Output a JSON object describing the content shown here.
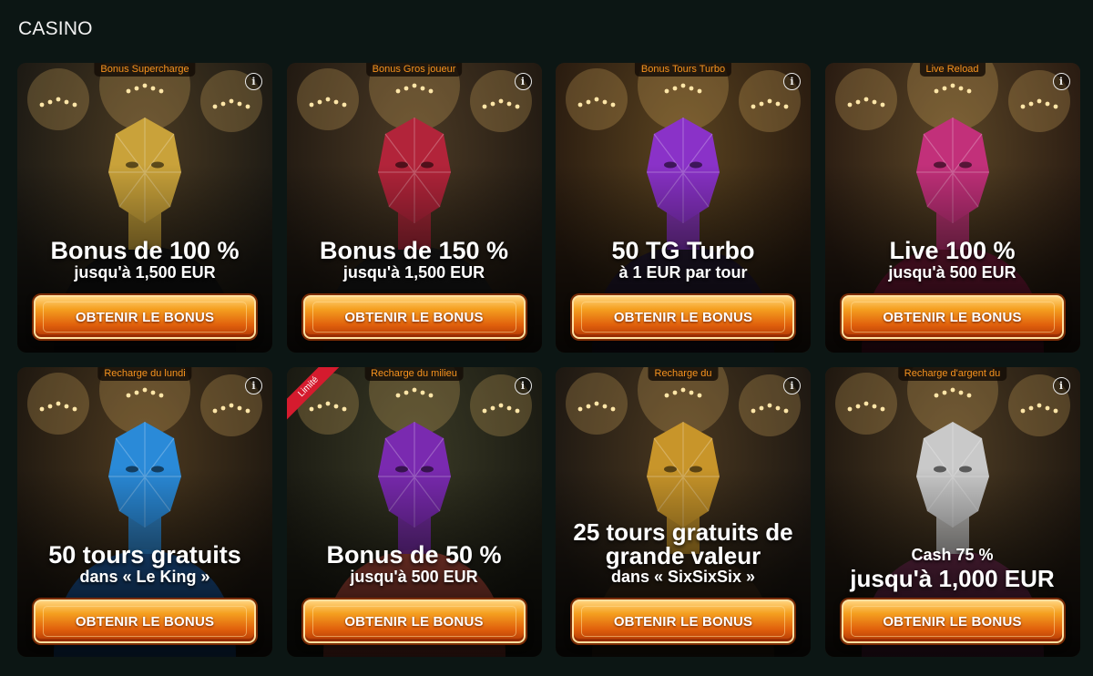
{
  "section_title": "CASINO",
  "cards": [
    {
      "tag": "Bonus Supercharge",
      "headline": "Bonus de 100 %",
      "sub": "jusqu'à 1,500 EUR",
      "button": "OBTENIR LE BONUS",
      "info": "i",
      "colors": {
        "bg1": "#4a3a22",
        "bg2": "#1d1a14",
        "face": "#c9a23a",
        "suit": "#141414"
      }
    },
    {
      "tag": "Bonus Gros joueur",
      "headline": "Bonus de 150 %",
      "sub": "jusqu'à 1,500 EUR",
      "button": "OBTENIR LE BONUS",
      "info": "i",
      "colors": {
        "bg1": "#4b3a25",
        "bg2": "#221a12",
        "face": "#b2243a",
        "suit": "#1c1c1c"
      }
    },
    {
      "tag": "Bonus Tours Turbo",
      "headline": "50 TG Turbo",
      "sub": "à 1 EUR par tour",
      "button": "OBTENIR LE BONUS",
      "info": "i",
      "colors": {
        "bg1": "#5a4320",
        "bg2": "#2a1c10",
        "face": "#8a32c8",
        "suit": "#241a30"
      }
    },
    {
      "tag": "Live Reload",
      "headline": "Live 100 %",
      "sub": "jusqu'à 500 EUR",
      "button": "OBTENIR LE BONUS",
      "info": "i",
      "colors": {
        "bg1": "#5a4526",
        "bg2": "#2a1c12",
        "face": "#c2307a",
        "suit": "#7a1a3a"
      }
    },
    {
      "tag": "Recharge du lundi",
      "headline": "50 tours gratuits",
      "sub": "dans « Le King »",
      "button": "OBTENIR LE BONUS",
      "info": "i",
      "colors": {
        "bg1": "#4d3a20",
        "bg2": "#1f1810",
        "face": "#2a8ad8",
        "suit": "#1e5aa0"
      }
    },
    {
      "tag": "Recharge du milieu",
      "headline": "Bonus de 50 %",
      "sub": "jusqu'à 500 EUR",
      "button": "OBTENIR LE BONUS",
      "info": "i",
      "ribbon": "Limité",
      "colors": {
        "bg1": "#3a3a26",
        "bg2": "#1a1a12",
        "face": "#7a2ab0",
        "suit": "#b04a3a"
      }
    },
    {
      "tag": "Recharge du",
      "headline": "25 tours gratuits de grande valeur",
      "sub": "dans « SixSixSix »",
      "button": "OBTENIR LE BONUS",
      "info": "i",
      "colors": {
        "bg1": "#4a3820",
        "bg2": "#1e1812",
        "face": "#c8952a",
        "suit": "#3a2a18"
      }
    },
    {
      "tag": "Recharge d'argent du",
      "headline": "jusqu'à 1,000 EUR",
      "sub": "Cash 75 %",
      "button": "OBTENIR LE BONUS",
      "info": "i",
      "colors": {
        "bg1": "#4d3c24",
        "bg2": "#201810",
        "face": "#c9c9c9",
        "suit": "#6a2a4a"
      }
    }
  ]
}
